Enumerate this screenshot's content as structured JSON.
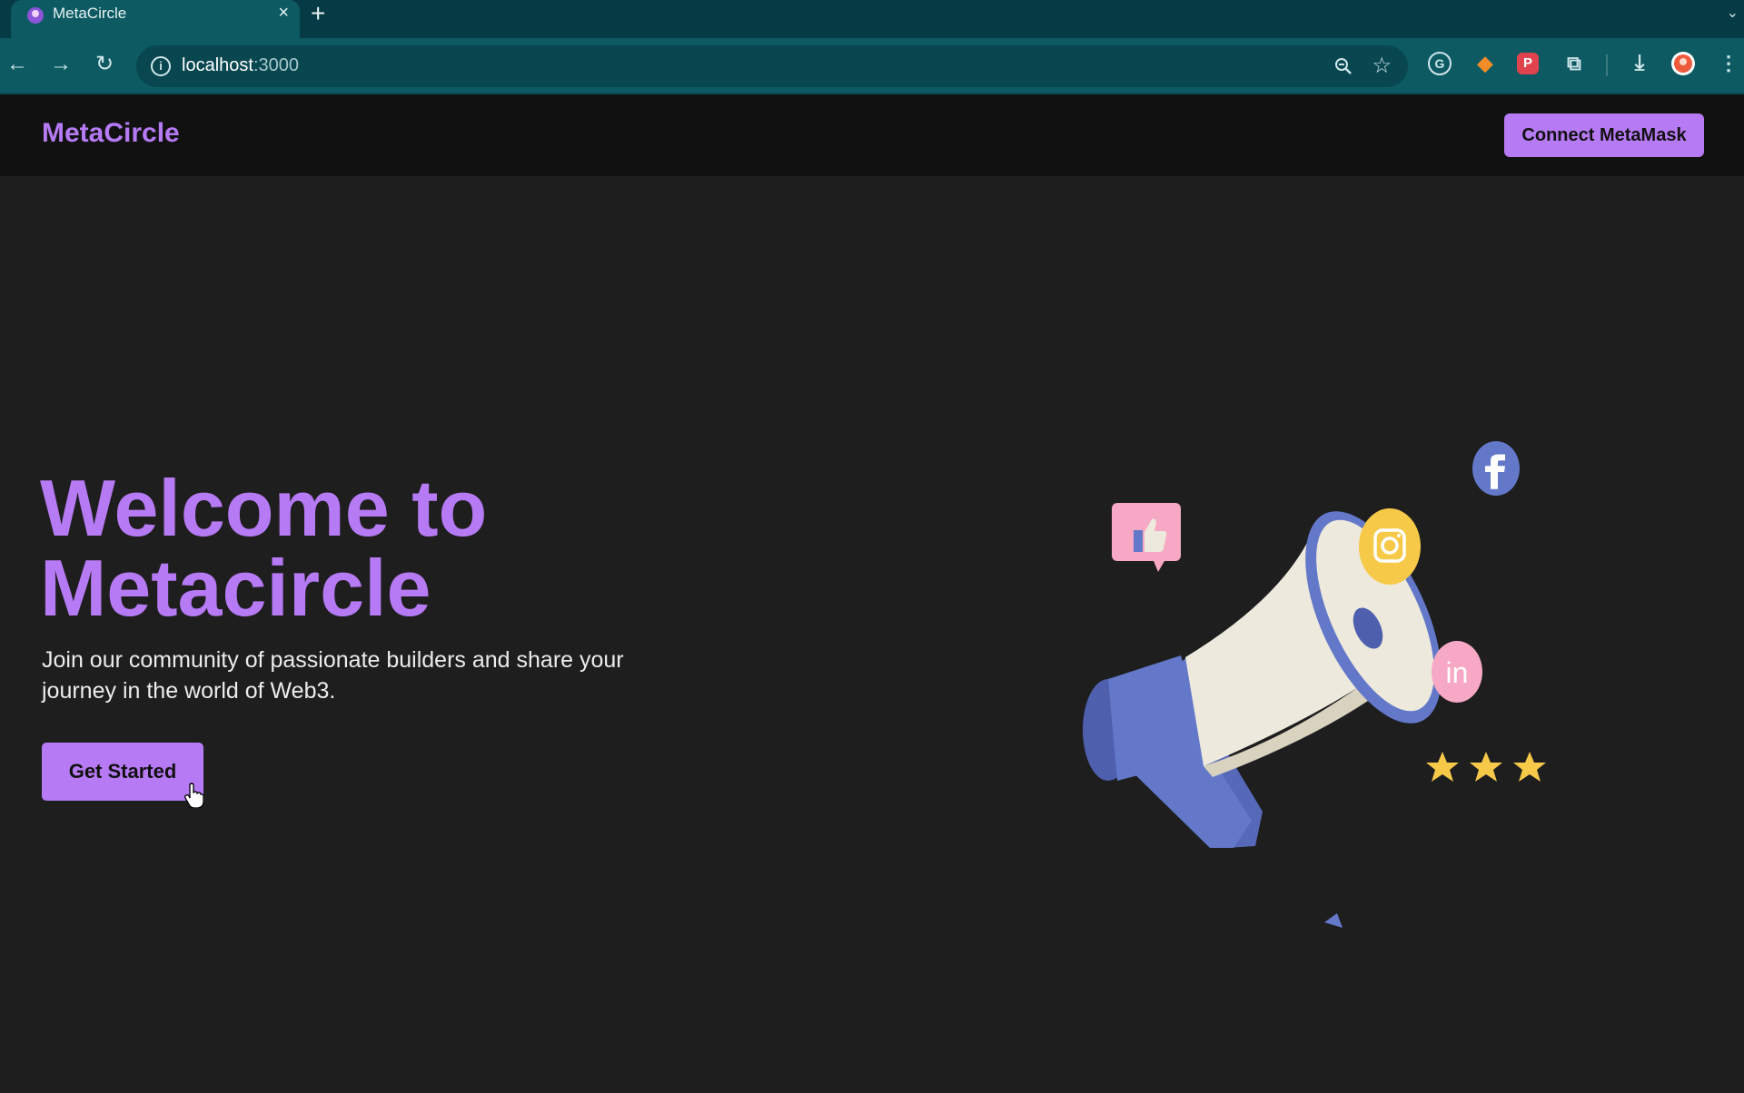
{
  "browser": {
    "tab_title": "MetaCircle",
    "close_glyph": "×",
    "new_tab_glyph": "+",
    "url_host": "localhost",
    "url_port": ":3000"
  },
  "navbar": {
    "brand": "MetaCircle",
    "connect_label": "Connect MetaMask"
  },
  "hero": {
    "title_line1": "Welcome to",
    "title_line2": "Metacircle",
    "subtitle": "Join our community of passionate builders and share your journey in the world of Web3.",
    "cta_label": "Get Started"
  },
  "illustration": {
    "icons": [
      "megaphone-icon",
      "thumbs-up-icon",
      "instagram-icon",
      "facebook-icon",
      "linkedin-icon",
      "star-icon"
    ],
    "colors": {
      "accent": "#b77af5",
      "megaphone_blue": "#6378c9",
      "cream": "#ede9dc",
      "yellow": "#f7c948",
      "pink": "#f7a8c4"
    }
  }
}
